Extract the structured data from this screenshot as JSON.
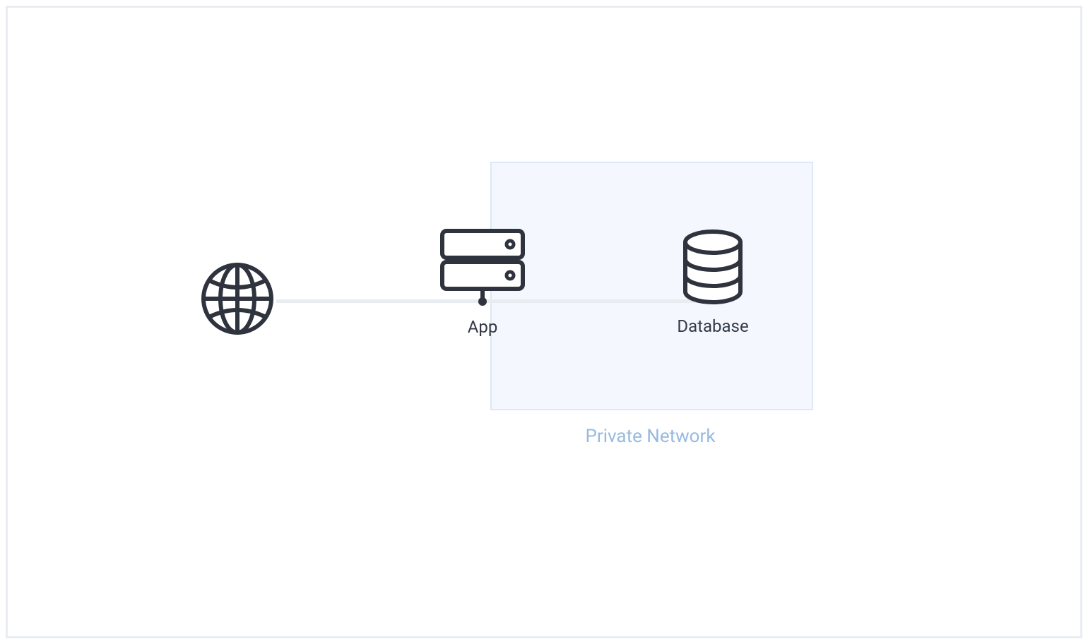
{
  "diagram": {
    "private_network_label": "Private Network",
    "nodes": {
      "globe": {
        "label": "",
        "icon": "globe-icon"
      },
      "app": {
        "label": "App",
        "icon": "server-icon"
      },
      "database": {
        "label": "Database",
        "icon": "database-icon"
      }
    },
    "colors": {
      "stroke": "#2f333d",
      "frame_border": "#e9edf1",
      "private_bg": "#f4f8fe",
      "private_border": "#dbe8f7",
      "private_text": "#98badf"
    }
  }
}
